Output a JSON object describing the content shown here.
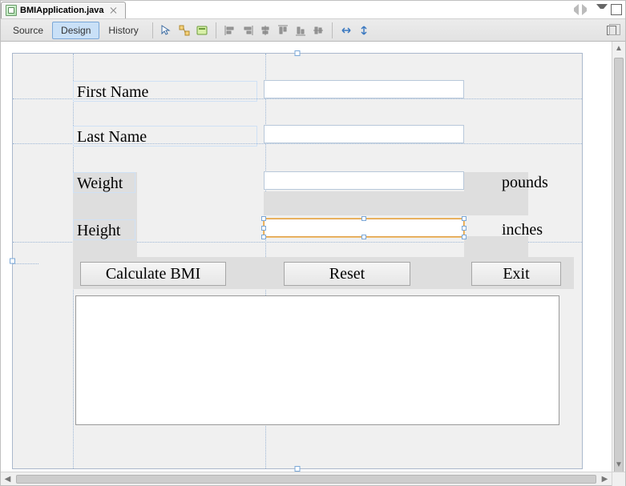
{
  "tab": {
    "filename": "BMIApplication.java"
  },
  "toolbar": {
    "views": {
      "source": "Source",
      "design": "Design",
      "history": "History"
    }
  },
  "form": {
    "first_name_label": "First Name",
    "first_name_value": "",
    "last_name_label": "Last Name",
    "last_name_value": "",
    "weight_label": "Weight",
    "weight_value": "",
    "weight_unit": "pounds",
    "height_label": "Height",
    "height_value": "",
    "height_unit": "inches",
    "calc_btn": "Calculate BMI",
    "reset_btn": "Reset",
    "exit_btn": "Exit",
    "output_value": ""
  }
}
